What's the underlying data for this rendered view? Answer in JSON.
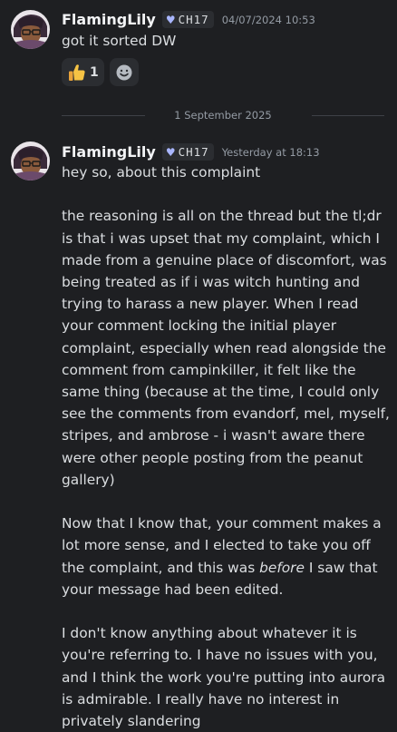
{
  "messages": [
    {
      "username": "FlamingLily",
      "tag_heart": "♥",
      "tag_text": "CH17",
      "timestamp": "04/07/2024 10:53",
      "text": "got it sorted DW",
      "reactions": [
        {
          "emoji": "thumbs-up",
          "count": "1"
        }
      ]
    },
    {
      "username": "FlamingLily",
      "tag_heart": "♥",
      "tag_text": "CH17",
      "timestamp": "Yesterday at 18:13",
      "paragraphs": [
        "hey so, about this complaint",
        "the reasoning is all on the thread but the tl;dr is that i was upset that my complaint, which I made from a genuine place of discomfort, was being treated as if i was witch hunting and trying to harass a new player. When I read your comment locking the initial player complaint, especially when read alongside the comment from campinkiller, it felt like the same thing (because at the time, I could only see the comments from evandorf, mel, myself, stripes, and ambrose - i wasn't aware there were other people posting from the peanut gallery)",
        {
          "before": "Now that I know that, your comment makes a lot more sense, and I elected to take you off the complaint, and this was ",
          "emphasis": "before",
          "after": " I saw that your message had been edited."
        },
        "I don't know anything about whatever it is you're referring to. I have no issues with you, and I think the work you're putting into aurora is admirable. I really have no interest in privately slandering"
      ]
    }
  ],
  "date_divider": "1 September 2025",
  "colors": {
    "background": "#1e1f22",
    "text": "#dbdee1",
    "username": "#f2f3f5",
    "muted": "#949ba4",
    "chip": "#2b2d31",
    "tag_heart": "#a9b6ff"
  }
}
